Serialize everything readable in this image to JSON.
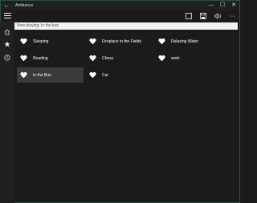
{
  "window": {
    "title": "Ambiance",
    "back_glyph": "←",
    "min_glyph": "—",
    "max_glyph": "☐",
    "close_glyph": "✕"
  },
  "toolbar": {
    "menu_icon": "hamburger-icon",
    "icons": [
      "stop-icon",
      "save-icon",
      "volume-icon",
      "more-icon"
    ],
    "more_glyph": "···"
  },
  "rail": {
    "icons": [
      "home-icon",
      "star-icon",
      "history-icon"
    ]
  },
  "now_playing": {
    "value": "Now playing: In the bus",
    "placeholder": "Now playing: In the bus"
  },
  "sounds": [
    {
      "label": "Sleeping",
      "selected": false
    },
    {
      "label": "Fireplace in the Fields",
      "selected": false
    },
    {
      "label": "Relaxing Water",
      "selected": false
    },
    {
      "label": "Reading",
      "selected": false
    },
    {
      "label": "Chess",
      "selected": false
    },
    {
      "label": "work",
      "selected": false
    },
    {
      "label": "In the Bus",
      "selected": true
    },
    {
      "label": "Car",
      "selected": false
    }
  ],
  "colors": {
    "background": "#1b1b1b",
    "selected_tile": "#3b3b3b",
    "window_border": "#2d4f40"
  }
}
